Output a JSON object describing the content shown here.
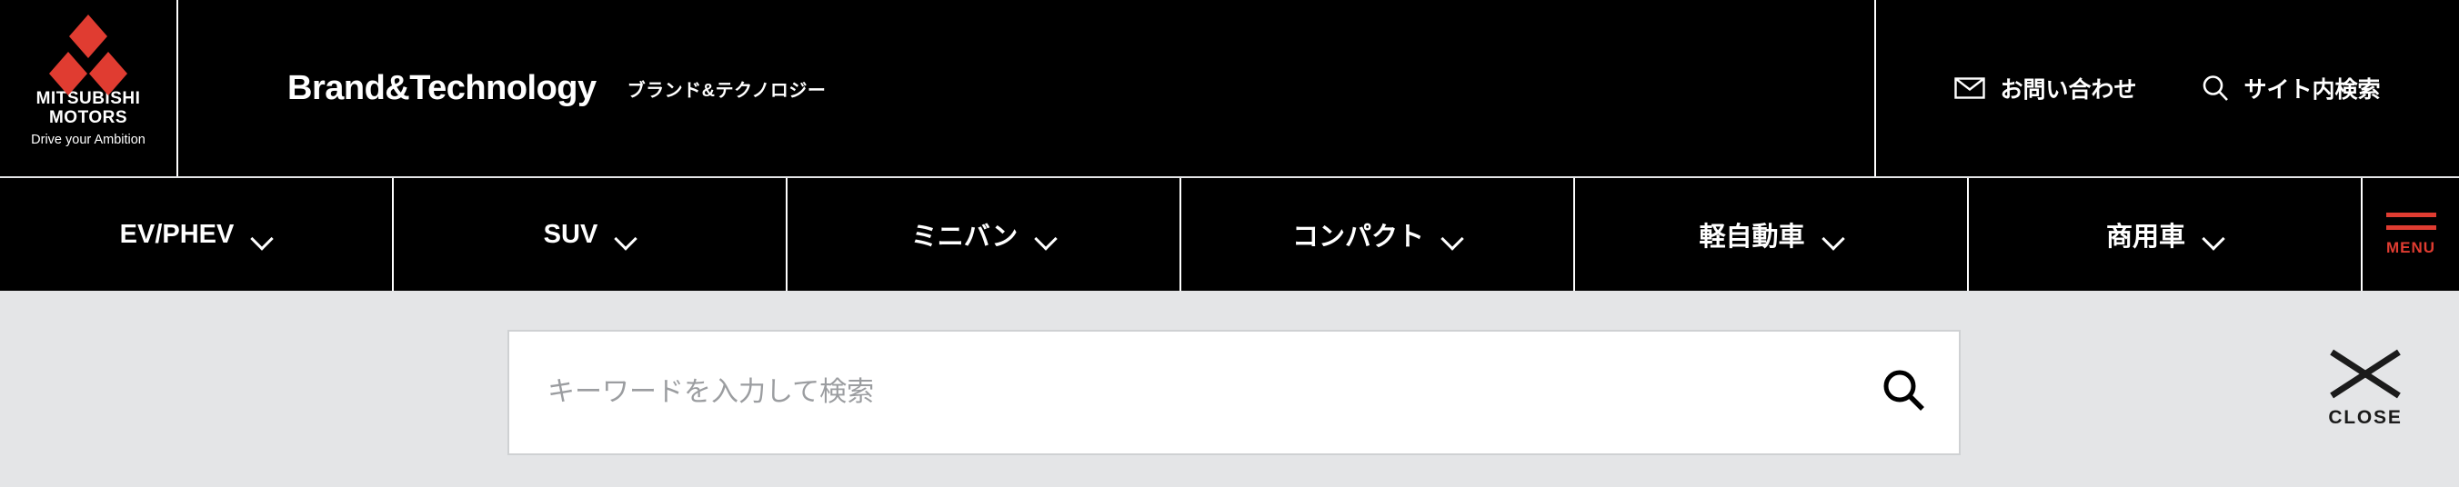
{
  "colors": {
    "brand_red": "#e03c31",
    "header_bg": "#000000",
    "panel_bg": "#e4e5e7",
    "input_bg": "#ffffff",
    "input_border": "#cfd1d3",
    "text_light": "#ffffff",
    "placeholder": "#9b9da0",
    "close_dark": "#1b1b1b"
  },
  "header": {
    "logo": {
      "icon": "mitsubishi-three-diamonds-icon",
      "wordmark_line1": "MITSUBISHI",
      "wordmark_line2": "MOTORS",
      "tagline": "Drive your Ambition"
    },
    "title": "Brand&Technology",
    "subtitle": "ブランド&テクノロジー",
    "utility_links": [
      {
        "icon": "mail-icon",
        "label": "お問い合わせ"
      },
      {
        "icon": "search-icon",
        "label": "サイト内検索"
      }
    ]
  },
  "nav": {
    "items": [
      {
        "label": "EV/PHEV",
        "icon": "chevron-down-icon"
      },
      {
        "label": "SUV",
        "icon": "chevron-down-icon"
      },
      {
        "label": "ミニバン",
        "icon": "chevron-down-icon"
      },
      {
        "label": "コンパクト",
        "icon": "chevron-down-icon"
      },
      {
        "label": "軽自動車",
        "icon": "chevron-down-icon"
      },
      {
        "label": "商用車",
        "icon": "chevron-down-icon"
      }
    ],
    "menu_button": {
      "icon": "hamburger-menu-icon",
      "label": "MENU"
    }
  },
  "search_panel": {
    "input": {
      "value": "",
      "placeholder": "キーワードを入力して検索"
    },
    "submit_icon": "search-icon",
    "close": {
      "icon": "close-x-icon",
      "label": "CLOSE"
    }
  }
}
